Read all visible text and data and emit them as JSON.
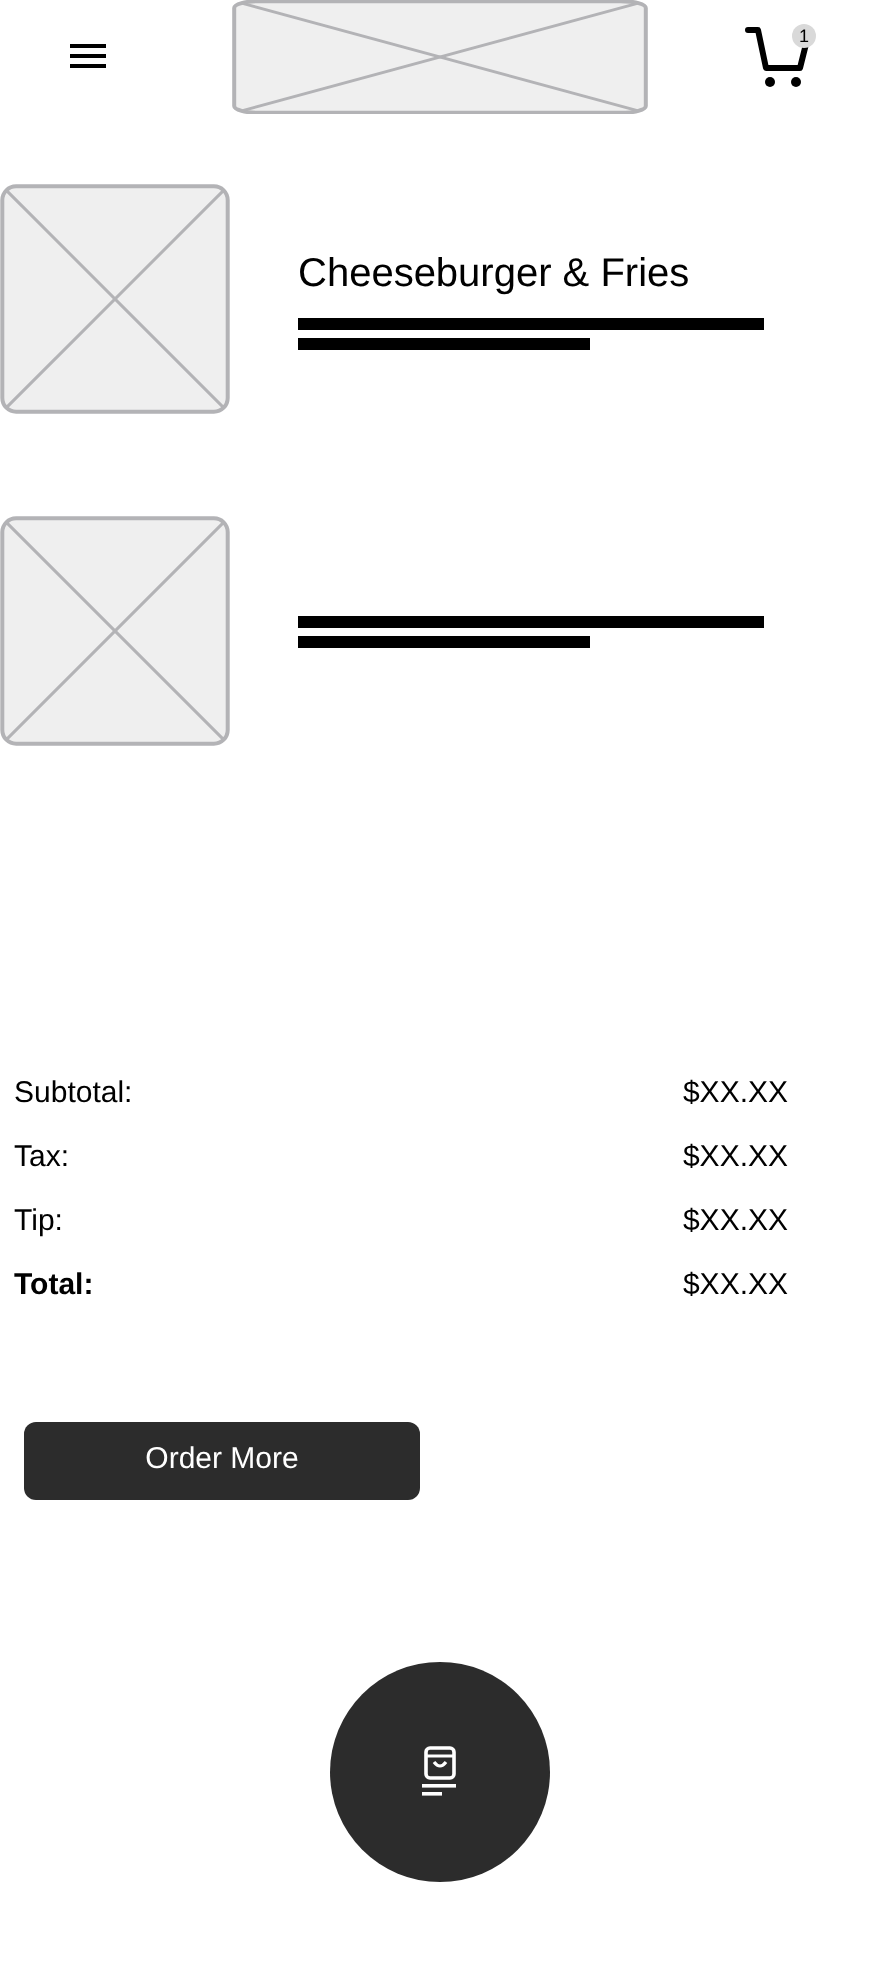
{
  "header": {
    "cart_badge": "1"
  },
  "items": [
    {
      "kind": "titled",
      "title": "Cheeseburger & Fries"
    },
    {
      "kind": "untitled"
    }
  ],
  "summary": [
    {
      "label": "Subtotal:",
      "amount": "$XX.XX",
      "bold": false
    },
    {
      "label": "Tax:",
      "amount": "$XX.XX",
      "bold": false
    },
    {
      "label": "Tip:",
      "amount": "$XX.XX",
      "bold": false
    },
    {
      "label": "Total:",
      "amount": "$XX.XX",
      "bold": true
    }
  ],
  "order_button": "Order More"
}
